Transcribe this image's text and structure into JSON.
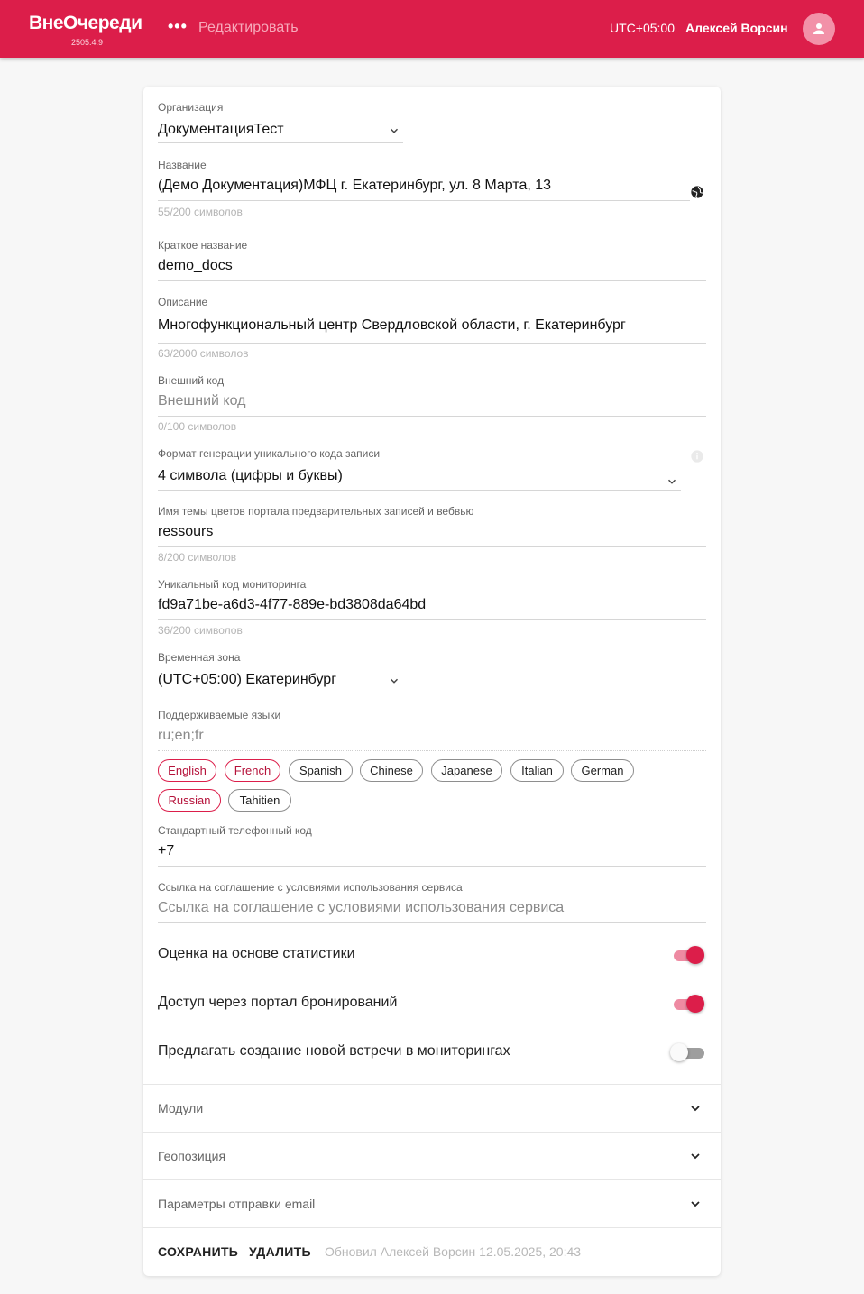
{
  "header": {
    "brand": "ВнеОчереди",
    "version": "2505.4.9",
    "more_label": "•••",
    "edit_link": "Редактировать",
    "timezone": "UTC+05:00",
    "username": "Алексей Ворсин",
    "accent": "#dc1e4a"
  },
  "form": {
    "organization": {
      "label": "Организация",
      "value": "ДокументацияТест"
    },
    "name": {
      "label": "Название",
      "value": "(Демо Документация)МФЦ г. Екатеринбург, ул. 8 Марта, 13",
      "counter": "55/200 символов",
      "icon": "globe-icon"
    },
    "short_name": {
      "label": "Краткое название",
      "value": "demo_docs"
    },
    "description": {
      "label": "Описание",
      "value": "Многофункциональный центр Свердловской области, г. Екатеринбург",
      "counter": "63/2000 символов"
    },
    "external_code": {
      "label": "Внешний код",
      "placeholder": "Внешний код",
      "counter": "0/100 символов"
    },
    "code_format": {
      "label": "Формат генерации уникального кода записи",
      "value": "4 символа (цифры и буквы)",
      "icon": "info-icon"
    },
    "theme": {
      "label": "Имя темы цветов портала предварительных записей и вебвью",
      "value": "ressours",
      "counter": "8/200 символов"
    },
    "monitoring_code": {
      "label": "Уникальный код мониторинга",
      "value": "fd9a71be-a6d3-4f77-889e-bd3808da64bd",
      "counter": "36/200 символов"
    },
    "time_zone": {
      "label": "Временная зона",
      "value": "(UTC+05:00) Екатеринбург"
    },
    "languages": {
      "label": "Поддерживаемые языки",
      "value": "ru;en;fr",
      "chips": [
        {
          "label": "English",
          "selected": true
        },
        {
          "label": "French",
          "selected": true
        },
        {
          "label": "Spanish",
          "selected": false
        },
        {
          "label": "Chinese",
          "selected": false
        },
        {
          "label": "Japanese",
          "selected": false
        },
        {
          "label": "Italian",
          "selected": false
        },
        {
          "label": "German",
          "selected": false
        },
        {
          "label": "Russian",
          "selected": true
        },
        {
          "label": "Tahitien",
          "selected": false
        }
      ]
    },
    "phone_code": {
      "label": "Стандартный телефонный код",
      "value": "+7"
    },
    "terms_link": {
      "label": "Ссылка на соглашение с условиями использования сервиса",
      "placeholder": "Ссылка на соглашение с условиями использования сервиса"
    },
    "switches": [
      {
        "label": "Оценка на основе статистики",
        "on": true
      },
      {
        "label": "Доступ через портал бронирований",
        "on": true
      },
      {
        "label": "Предлагать создание новой встречи в мониторингах",
        "on": false
      }
    ],
    "accordions": [
      {
        "label": "Модули"
      },
      {
        "label": "Геопозиция"
      },
      {
        "label": "Параметры отправки email"
      }
    ]
  },
  "actions": {
    "save": "СОХРАНИТЬ",
    "delete": "УДАЛИТЬ",
    "updated": "Обновил Алексей Ворсин 12.05.2025, 20:43"
  }
}
